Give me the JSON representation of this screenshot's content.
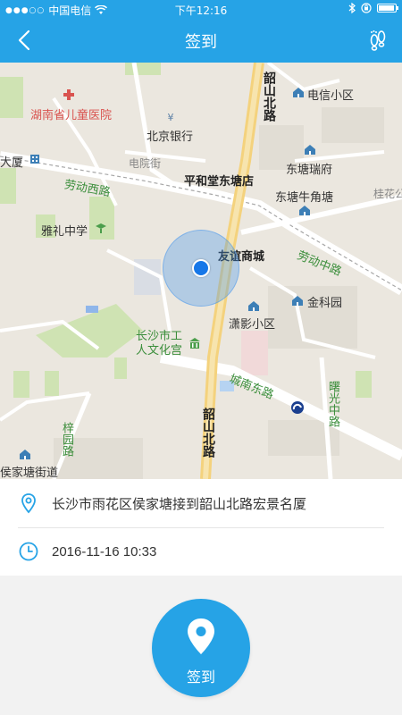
{
  "status_bar": {
    "signal_dots": "●●●○○",
    "carrier": "中国电信",
    "time": "下午12:16"
  },
  "header": {
    "title": "签到"
  },
  "map": {
    "labels": {
      "hospital": "湖南省儿童医院",
      "bank": "北京银行",
      "dianyuan_street": "电院街",
      "dasha": "大厦",
      "laodong_west": "劳动西路",
      "yali": "雅礼中学",
      "pinghetang": "平和堂东塘店",
      "shaoshan_north_1": "韶山北路",
      "dianxin": "电信小区",
      "dongtang_ruifu": "东塘瑞府",
      "dongtang_niujiaotang": "东塘牛角塘",
      "guihua": "桂花公",
      "youyi": "友谊商城",
      "laodong_middle": "劳动中路",
      "jinkeyuan": "金科园",
      "xiaoying": "潇影小区",
      "worker_palace": "长沙市工\n人文化宫",
      "chengnan_east": "城南东路",
      "shuguang_middle": "曙光中路",
      "shaoshan_north_2": "韶山北路",
      "ziyuan": "梓园路",
      "houjiatang_street": "侯家塘街道"
    }
  },
  "location": {
    "address": "长沙市雨花区侯家塘接到韶山北路宏景名厦",
    "datetime": "2016-11-16 10:33"
  },
  "signin_button": {
    "label": "签到"
  },
  "colors": {
    "primary": "#26a3e6",
    "location_dot": "#1677e8"
  }
}
